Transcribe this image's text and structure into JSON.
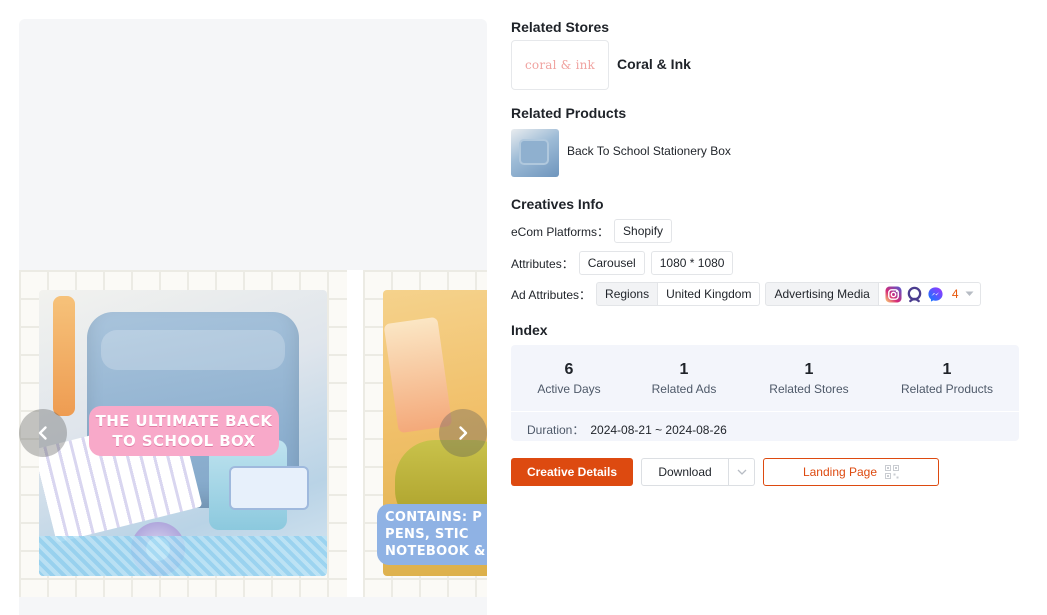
{
  "slides": [
    {
      "banner": "THE ULTIMATE BACK\nTO SCHOOL BOX"
    },
    {
      "banner": "CONTAINS: P\nPENS, STIC\nNOTEBOOK & S"
    }
  ],
  "related_stores": {
    "title": "Related Stores",
    "logo_text": "coral & ink",
    "name": "Coral & Ink"
  },
  "related_products": {
    "title": "Related Products",
    "name": "Back To School Stationery Box"
  },
  "creatives_info": {
    "title": "Creatives Info",
    "ecom_label": "eCom Platforms：",
    "ecom_value": "Shopify",
    "attributes_label": "Attributes：",
    "attributes": [
      "Carousel",
      "1080 * 1080"
    ],
    "ad_attributes_label": "Ad Attributes：",
    "regions_label": "Regions",
    "regions_value": "United Kingdom",
    "media_label": "Advertising Media",
    "media_icons": [
      "instagram-icon",
      "audience-network-icon",
      "messenger-icon"
    ],
    "media_more_count": "4"
  },
  "index": {
    "title": "Index",
    "stats": [
      {
        "value": "6",
        "label": "Active Days"
      },
      {
        "value": "1",
        "label": "Related Ads"
      },
      {
        "value": "1",
        "label": "Related Stores"
      },
      {
        "value": "1",
        "label": "Related Products"
      }
    ],
    "duration_label": "Duration：",
    "duration_value": "2024-08-21 ~ 2024-08-26"
  },
  "actions": {
    "creative_details": "Creative Details",
    "download": "Download",
    "landing_page": "Landing Page"
  },
  "colors": {
    "accent": "#dd4a10",
    "index_bg": "#f3f5fb",
    "media_count": "#e8590c"
  }
}
